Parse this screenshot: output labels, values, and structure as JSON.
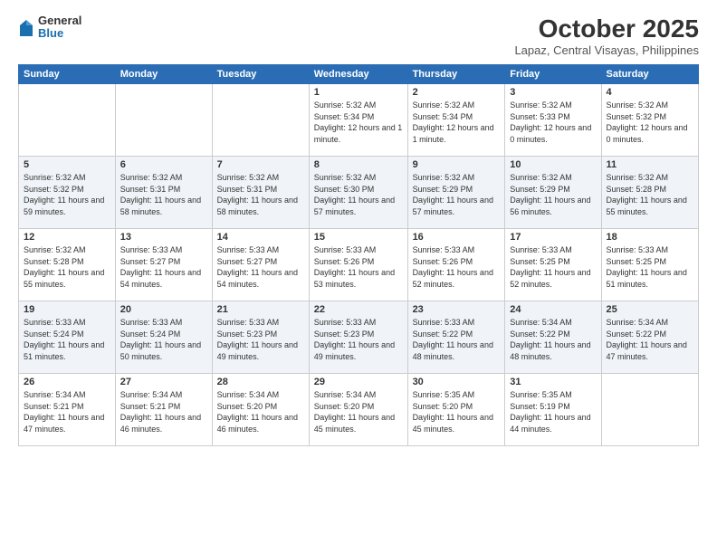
{
  "header": {
    "logo": {
      "general": "General",
      "blue": "Blue"
    },
    "title": "October 2025",
    "location": "Lapaz, Central Visayas, Philippines"
  },
  "days_of_week": [
    "Sunday",
    "Monday",
    "Tuesday",
    "Wednesday",
    "Thursday",
    "Friday",
    "Saturday"
  ],
  "weeks": [
    [
      {
        "day": "",
        "sunrise": "",
        "sunset": "",
        "daylight": ""
      },
      {
        "day": "",
        "sunrise": "",
        "sunset": "",
        "daylight": ""
      },
      {
        "day": "",
        "sunrise": "",
        "sunset": "",
        "daylight": ""
      },
      {
        "day": "1",
        "sunrise": "Sunrise: 5:32 AM",
        "sunset": "Sunset: 5:34 PM",
        "daylight": "Daylight: 12 hours and 1 minute."
      },
      {
        "day": "2",
        "sunrise": "Sunrise: 5:32 AM",
        "sunset": "Sunset: 5:34 PM",
        "daylight": "Daylight: 12 hours and 1 minute."
      },
      {
        "day": "3",
        "sunrise": "Sunrise: 5:32 AM",
        "sunset": "Sunset: 5:33 PM",
        "daylight": "Daylight: 12 hours and 0 minutes."
      },
      {
        "day": "4",
        "sunrise": "Sunrise: 5:32 AM",
        "sunset": "Sunset: 5:32 PM",
        "daylight": "Daylight: 12 hours and 0 minutes."
      }
    ],
    [
      {
        "day": "5",
        "sunrise": "Sunrise: 5:32 AM",
        "sunset": "Sunset: 5:32 PM",
        "daylight": "Daylight: 11 hours and 59 minutes."
      },
      {
        "day": "6",
        "sunrise": "Sunrise: 5:32 AM",
        "sunset": "Sunset: 5:31 PM",
        "daylight": "Daylight: 11 hours and 58 minutes."
      },
      {
        "day": "7",
        "sunrise": "Sunrise: 5:32 AM",
        "sunset": "Sunset: 5:31 PM",
        "daylight": "Daylight: 11 hours and 58 minutes."
      },
      {
        "day": "8",
        "sunrise": "Sunrise: 5:32 AM",
        "sunset": "Sunset: 5:30 PM",
        "daylight": "Daylight: 11 hours and 57 minutes."
      },
      {
        "day": "9",
        "sunrise": "Sunrise: 5:32 AM",
        "sunset": "Sunset: 5:29 PM",
        "daylight": "Daylight: 11 hours and 57 minutes."
      },
      {
        "day": "10",
        "sunrise": "Sunrise: 5:32 AM",
        "sunset": "Sunset: 5:29 PM",
        "daylight": "Daylight: 11 hours and 56 minutes."
      },
      {
        "day": "11",
        "sunrise": "Sunrise: 5:32 AM",
        "sunset": "Sunset: 5:28 PM",
        "daylight": "Daylight: 11 hours and 55 minutes."
      }
    ],
    [
      {
        "day": "12",
        "sunrise": "Sunrise: 5:32 AM",
        "sunset": "Sunset: 5:28 PM",
        "daylight": "Daylight: 11 hours and 55 minutes."
      },
      {
        "day": "13",
        "sunrise": "Sunrise: 5:33 AM",
        "sunset": "Sunset: 5:27 PM",
        "daylight": "Daylight: 11 hours and 54 minutes."
      },
      {
        "day": "14",
        "sunrise": "Sunrise: 5:33 AM",
        "sunset": "Sunset: 5:27 PM",
        "daylight": "Daylight: 11 hours and 54 minutes."
      },
      {
        "day": "15",
        "sunrise": "Sunrise: 5:33 AM",
        "sunset": "Sunset: 5:26 PM",
        "daylight": "Daylight: 11 hours and 53 minutes."
      },
      {
        "day": "16",
        "sunrise": "Sunrise: 5:33 AM",
        "sunset": "Sunset: 5:26 PM",
        "daylight": "Daylight: 11 hours and 52 minutes."
      },
      {
        "day": "17",
        "sunrise": "Sunrise: 5:33 AM",
        "sunset": "Sunset: 5:25 PM",
        "daylight": "Daylight: 11 hours and 52 minutes."
      },
      {
        "day": "18",
        "sunrise": "Sunrise: 5:33 AM",
        "sunset": "Sunset: 5:25 PM",
        "daylight": "Daylight: 11 hours and 51 minutes."
      }
    ],
    [
      {
        "day": "19",
        "sunrise": "Sunrise: 5:33 AM",
        "sunset": "Sunset: 5:24 PM",
        "daylight": "Daylight: 11 hours and 51 minutes."
      },
      {
        "day": "20",
        "sunrise": "Sunrise: 5:33 AM",
        "sunset": "Sunset: 5:24 PM",
        "daylight": "Daylight: 11 hours and 50 minutes."
      },
      {
        "day": "21",
        "sunrise": "Sunrise: 5:33 AM",
        "sunset": "Sunset: 5:23 PM",
        "daylight": "Daylight: 11 hours and 49 minutes."
      },
      {
        "day": "22",
        "sunrise": "Sunrise: 5:33 AM",
        "sunset": "Sunset: 5:23 PM",
        "daylight": "Daylight: 11 hours and 49 minutes."
      },
      {
        "day": "23",
        "sunrise": "Sunrise: 5:33 AM",
        "sunset": "Sunset: 5:22 PM",
        "daylight": "Daylight: 11 hours and 48 minutes."
      },
      {
        "day": "24",
        "sunrise": "Sunrise: 5:34 AM",
        "sunset": "Sunset: 5:22 PM",
        "daylight": "Daylight: 11 hours and 48 minutes."
      },
      {
        "day": "25",
        "sunrise": "Sunrise: 5:34 AM",
        "sunset": "Sunset: 5:22 PM",
        "daylight": "Daylight: 11 hours and 47 minutes."
      }
    ],
    [
      {
        "day": "26",
        "sunrise": "Sunrise: 5:34 AM",
        "sunset": "Sunset: 5:21 PM",
        "daylight": "Daylight: 11 hours and 47 minutes."
      },
      {
        "day": "27",
        "sunrise": "Sunrise: 5:34 AM",
        "sunset": "Sunset: 5:21 PM",
        "daylight": "Daylight: 11 hours and 46 minutes."
      },
      {
        "day": "28",
        "sunrise": "Sunrise: 5:34 AM",
        "sunset": "Sunset: 5:20 PM",
        "daylight": "Daylight: 11 hours and 46 minutes."
      },
      {
        "day": "29",
        "sunrise": "Sunrise: 5:34 AM",
        "sunset": "Sunset: 5:20 PM",
        "daylight": "Daylight: 11 hours and 45 minutes."
      },
      {
        "day": "30",
        "sunrise": "Sunrise: 5:35 AM",
        "sunset": "Sunset: 5:20 PM",
        "daylight": "Daylight: 11 hours and 45 minutes."
      },
      {
        "day": "31",
        "sunrise": "Sunrise: 5:35 AM",
        "sunset": "Sunset: 5:19 PM",
        "daylight": "Daylight: 11 hours and 44 minutes."
      },
      {
        "day": "",
        "sunrise": "",
        "sunset": "",
        "daylight": ""
      }
    ]
  ]
}
